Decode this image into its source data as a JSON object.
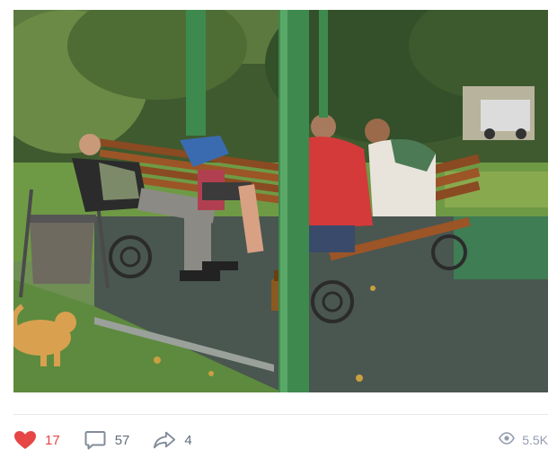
{
  "post": {
    "photo_alt": "",
    "likes": "17",
    "comments": "57",
    "shares": "4",
    "views": "5.5K"
  },
  "icons": {
    "like": "heart-icon",
    "comment": "comment-icon",
    "share": "share-arrow-icon",
    "views": "eye-icon"
  },
  "colors": {
    "like_active": "#e64646",
    "counter_text": "#626d7a",
    "views_text": "#939cb0",
    "divider": "#e7e8ec"
  }
}
